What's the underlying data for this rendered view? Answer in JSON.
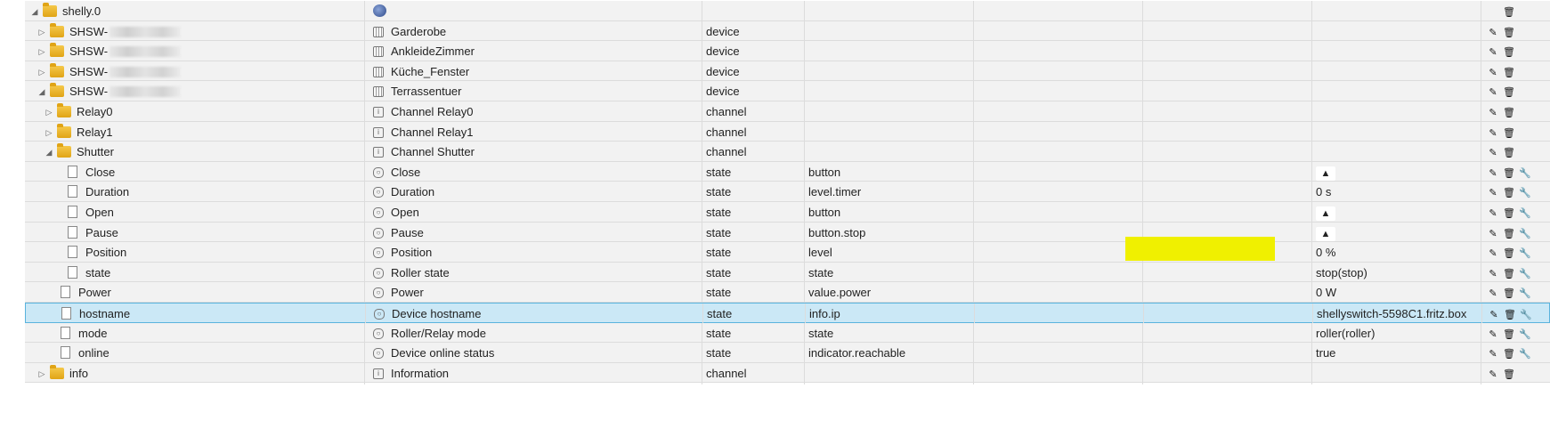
{
  "tree": {
    "rows": [
      {
        "id": "shelly.0",
        "name": "",
        "type": "",
        "role": "",
        "value": "",
        "depth": 0,
        "toggle": "expanded",
        "icon": "folder",
        "name_icon": "adapter",
        "buttons": [
          "delete"
        ],
        "control": ""
      },
      {
        "id": "SHSW-",
        "name": "Garderobe",
        "type": "device",
        "role": "",
        "value": "",
        "depth": 1,
        "toggle": "collapsed",
        "icon": "folder",
        "name_icon": "device",
        "buttons": [
          "edit",
          "delete"
        ],
        "control": "",
        "blurred": true
      },
      {
        "id": "SHSW-",
        "name": "AnkleideZimmer",
        "type": "device",
        "role": "",
        "value": "",
        "depth": 1,
        "toggle": "collapsed",
        "icon": "folder",
        "name_icon": "device",
        "buttons": [
          "edit",
          "delete"
        ],
        "control": "",
        "blurred": true
      },
      {
        "id": "SHSW-",
        "name": "Küche_Fenster",
        "type": "device",
        "role": "",
        "value": "",
        "depth": 1,
        "toggle": "collapsed",
        "icon": "folder",
        "name_icon": "device",
        "buttons": [
          "edit",
          "delete"
        ],
        "control": "",
        "blurred": true
      },
      {
        "id": "SHSW-",
        "name": "Terrassentuer",
        "type": "device",
        "role": "",
        "value": "",
        "depth": 1,
        "toggle": "expanded",
        "icon": "folder",
        "name_icon": "device",
        "buttons": [
          "edit",
          "delete"
        ],
        "control": "",
        "blurred": true
      },
      {
        "id": "Relay0",
        "name": "Channel Relay0",
        "type": "channel",
        "role": "",
        "value": "",
        "depth": 2,
        "toggle": "collapsed",
        "icon": "folder",
        "name_icon": "channel",
        "buttons": [
          "edit",
          "delete"
        ],
        "control": ""
      },
      {
        "id": "Relay1",
        "name": "Channel Relay1",
        "type": "channel",
        "role": "",
        "value": "",
        "depth": 2,
        "toggle": "collapsed",
        "icon": "folder",
        "name_icon": "channel",
        "buttons": [
          "edit",
          "delete"
        ],
        "control": ""
      },
      {
        "id": "Shutter",
        "name": "Channel Shutter",
        "type": "channel",
        "role": "",
        "value": "",
        "depth": 2,
        "toggle": "expanded",
        "icon": "folder",
        "name_icon": "channel",
        "buttons": [
          "edit",
          "delete"
        ],
        "control": ""
      },
      {
        "id": "Close",
        "name": "Close",
        "type": "state",
        "role": "button",
        "value": "",
        "depth": 3,
        "toggle": "",
        "icon": "file",
        "name_icon": "state",
        "buttons": [
          "edit",
          "delete",
          "settings"
        ],
        "control": "▲"
      },
      {
        "id": "Duration",
        "name": "Duration",
        "type": "state",
        "role": "level.timer",
        "value": "0 s",
        "depth": 3,
        "toggle": "",
        "icon": "file",
        "name_icon": "state",
        "buttons": [
          "edit",
          "delete",
          "settings"
        ],
        "control": ""
      },
      {
        "id": "Open",
        "name": "Open",
        "type": "state",
        "role": "button",
        "value": "",
        "depth": 3,
        "toggle": "",
        "icon": "file",
        "name_icon": "state",
        "buttons": [
          "edit",
          "delete",
          "settings"
        ],
        "control": "▲"
      },
      {
        "id": "Pause",
        "name": "Pause",
        "type": "state",
        "role": "button.stop",
        "value": "",
        "depth": 3,
        "toggle": "",
        "icon": "file",
        "name_icon": "state",
        "buttons": [
          "edit",
          "delete",
          "settings"
        ],
        "control": "▲"
      },
      {
        "id": "Position",
        "name": "Position",
        "type": "state",
        "role": "level",
        "value": "0 %",
        "depth": 3,
        "toggle": "",
        "icon": "file",
        "name_icon": "state",
        "buttons": [
          "edit",
          "delete",
          "settings"
        ],
        "control": ""
      },
      {
        "id": "state",
        "name": "Roller state",
        "type": "state",
        "role": "state",
        "value": "stop(stop)",
        "depth": 3,
        "toggle": "",
        "icon": "file",
        "name_icon": "state",
        "buttons": [
          "edit",
          "delete",
          "settings"
        ],
        "control": ""
      },
      {
        "id": "Power",
        "name": "Power",
        "type": "state",
        "role": "value.power",
        "value": "0 W",
        "depth": 2,
        "toggle": "",
        "icon": "file",
        "name_icon": "state",
        "buttons": [
          "edit",
          "delete",
          "settings"
        ],
        "control": ""
      },
      {
        "id": "hostname",
        "name": "Device hostname",
        "type": "state",
        "role": "info.ip",
        "value": "shellyswitch-5598C1.fritz.box",
        "depth": 2,
        "toggle": "",
        "icon": "file",
        "name_icon": "state",
        "buttons": [
          "edit",
          "delete",
          "settings"
        ],
        "control": "",
        "selected": true
      },
      {
        "id": "mode",
        "name": "Roller/Relay mode",
        "type": "state",
        "role": "state",
        "value": "roller(roller)",
        "depth": 2,
        "toggle": "",
        "icon": "file",
        "name_icon": "state",
        "buttons": [
          "edit",
          "delete",
          "settings"
        ],
        "control": ""
      },
      {
        "id": "online",
        "name": "Device online status",
        "type": "state",
        "role": "indicator.reachable",
        "value": "true",
        "depth": 2,
        "toggle": "",
        "icon": "file",
        "name_icon": "state",
        "buttons": [
          "edit",
          "delete",
          "settings"
        ],
        "control": ""
      },
      {
        "id": "info",
        "name": "Information",
        "type": "channel",
        "role": "",
        "value": "",
        "depth": 1,
        "toggle": "collapsed",
        "icon": "folder",
        "name_icon": "channel",
        "buttons": [
          "edit",
          "delete"
        ],
        "control": ""
      }
    ]
  },
  "icons": {
    "edit": "pencil-icon",
    "delete": "trash-icon",
    "settings": "wrench-icon",
    "expanded": "triangle-down-icon",
    "collapsed": "triangle-right-icon"
  },
  "colors": {
    "row": "#f2f2f2",
    "selected": "#cbe8f6",
    "highlight": "#f0f000",
    "folder": "#e8b22a"
  }
}
